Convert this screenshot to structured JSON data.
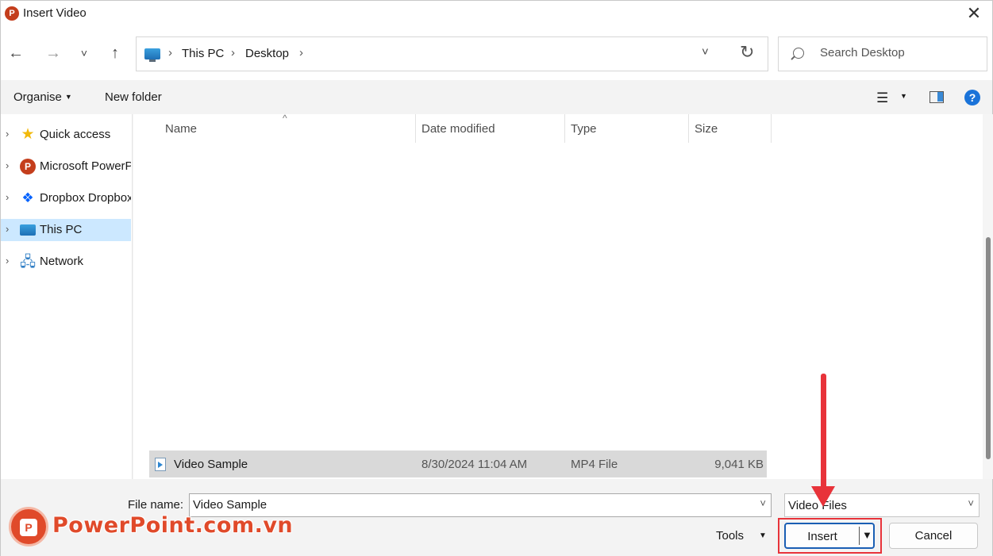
{
  "window": {
    "title": "Insert Video",
    "app_icon_letter": "P",
    "close_glyph": "✕"
  },
  "nav": {
    "back": "←",
    "forward": "→",
    "recent": "˅",
    "up": "↑"
  },
  "address": {
    "crumbs": [
      "This PC",
      "Desktop"
    ],
    "separator": "›",
    "dropdown": "˅",
    "refresh": "↻"
  },
  "search": {
    "placeholder": "Search Desktop"
  },
  "toolbar": {
    "organise": "Organise",
    "new_folder": "New folder",
    "help": "?"
  },
  "sidebar": {
    "items": [
      {
        "label": "Quick access",
        "icon": "star-icon"
      },
      {
        "label": "Microsoft PowerPoint",
        "icon": "powerpoint-icon"
      },
      {
        "label": "Dropbox Dropbox",
        "icon": "dropbox-icon"
      },
      {
        "label": "This PC",
        "icon": "computer-icon",
        "selected": true
      },
      {
        "label": "Network",
        "icon": "network-icon"
      }
    ]
  },
  "columns": {
    "name": "Name",
    "date_modified": "Date modified",
    "type": "Type",
    "size": "Size"
  },
  "files": [
    {
      "name": "Video Sample",
      "date": "8/30/2024 11:04 AM",
      "type": "MP4 File",
      "size": "9,041 KB"
    }
  ],
  "bottom": {
    "file_name_label": "File name:",
    "file_name_value": "Video Sample",
    "file_type": "Video Files",
    "tools": "Tools",
    "insert": "Insert",
    "cancel": "Cancel"
  },
  "watermark": {
    "text": "PowerPoint.com.vn"
  },
  "colors": {
    "accent": "#1a5fb4",
    "highlight": "#e8333a",
    "selected_nav": "#cce8ff",
    "brand": "#e04a2a"
  }
}
